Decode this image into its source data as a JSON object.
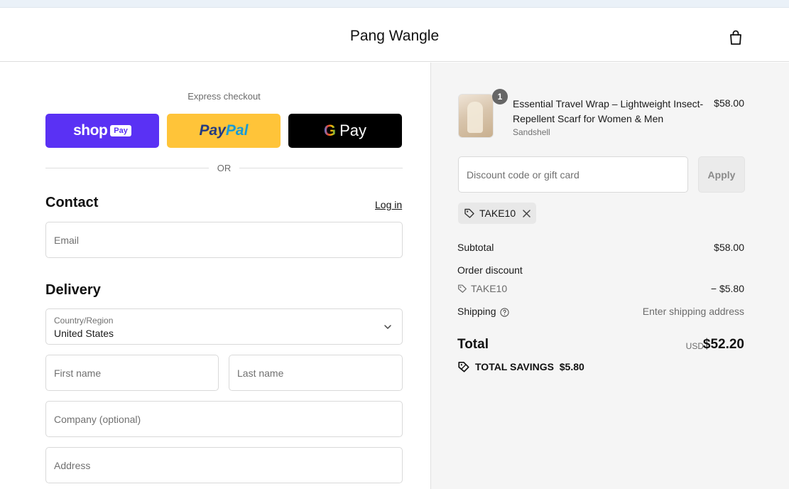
{
  "header": {
    "store_name": "Pang Wangle"
  },
  "express": {
    "label": "Express checkout",
    "shop_pay": {
      "word": "shop",
      "badge": "Pay"
    },
    "paypal": {
      "part_a": "Pay",
      "part_b": "Pal"
    },
    "gpay": {
      "g": "G",
      "word": "Pay"
    },
    "or": "OR"
  },
  "contact": {
    "title": "Contact",
    "login": "Log in",
    "email_placeholder": "Email"
  },
  "delivery": {
    "title": "Delivery",
    "country_label": "Country/Region",
    "country_value": "United States",
    "first_name": "First name",
    "last_name": "Last name",
    "company": "Company (optional)",
    "address": "Address"
  },
  "summary": {
    "product": {
      "quantity": "1",
      "name": "Essential Travel Wrap – Lightweight Insect-Repellent Scarf for Women & Men",
      "vendor": "Sandshell",
      "price": "$58.00"
    },
    "discount_placeholder": "Discount code or gift card",
    "apply": "Apply",
    "applied_code": "TAKE10",
    "subtotal_label": "Subtotal",
    "subtotal_value": "$58.00",
    "order_discount_label": "Order discount",
    "order_discount_code": "TAKE10",
    "order_discount_value": "− $5.80",
    "shipping_label": "Shipping",
    "shipping_value": "Enter shipping address",
    "total_label": "Total",
    "currency": "USD",
    "total_value": "$52.20",
    "savings": "TOTAL SAVINGS  $5.80"
  },
  "colors": {
    "shop_pay": "#5a31f4",
    "paypal": "#ffc439",
    "gpay": "#000000",
    "summary_bg": "#f5f5f5"
  }
}
